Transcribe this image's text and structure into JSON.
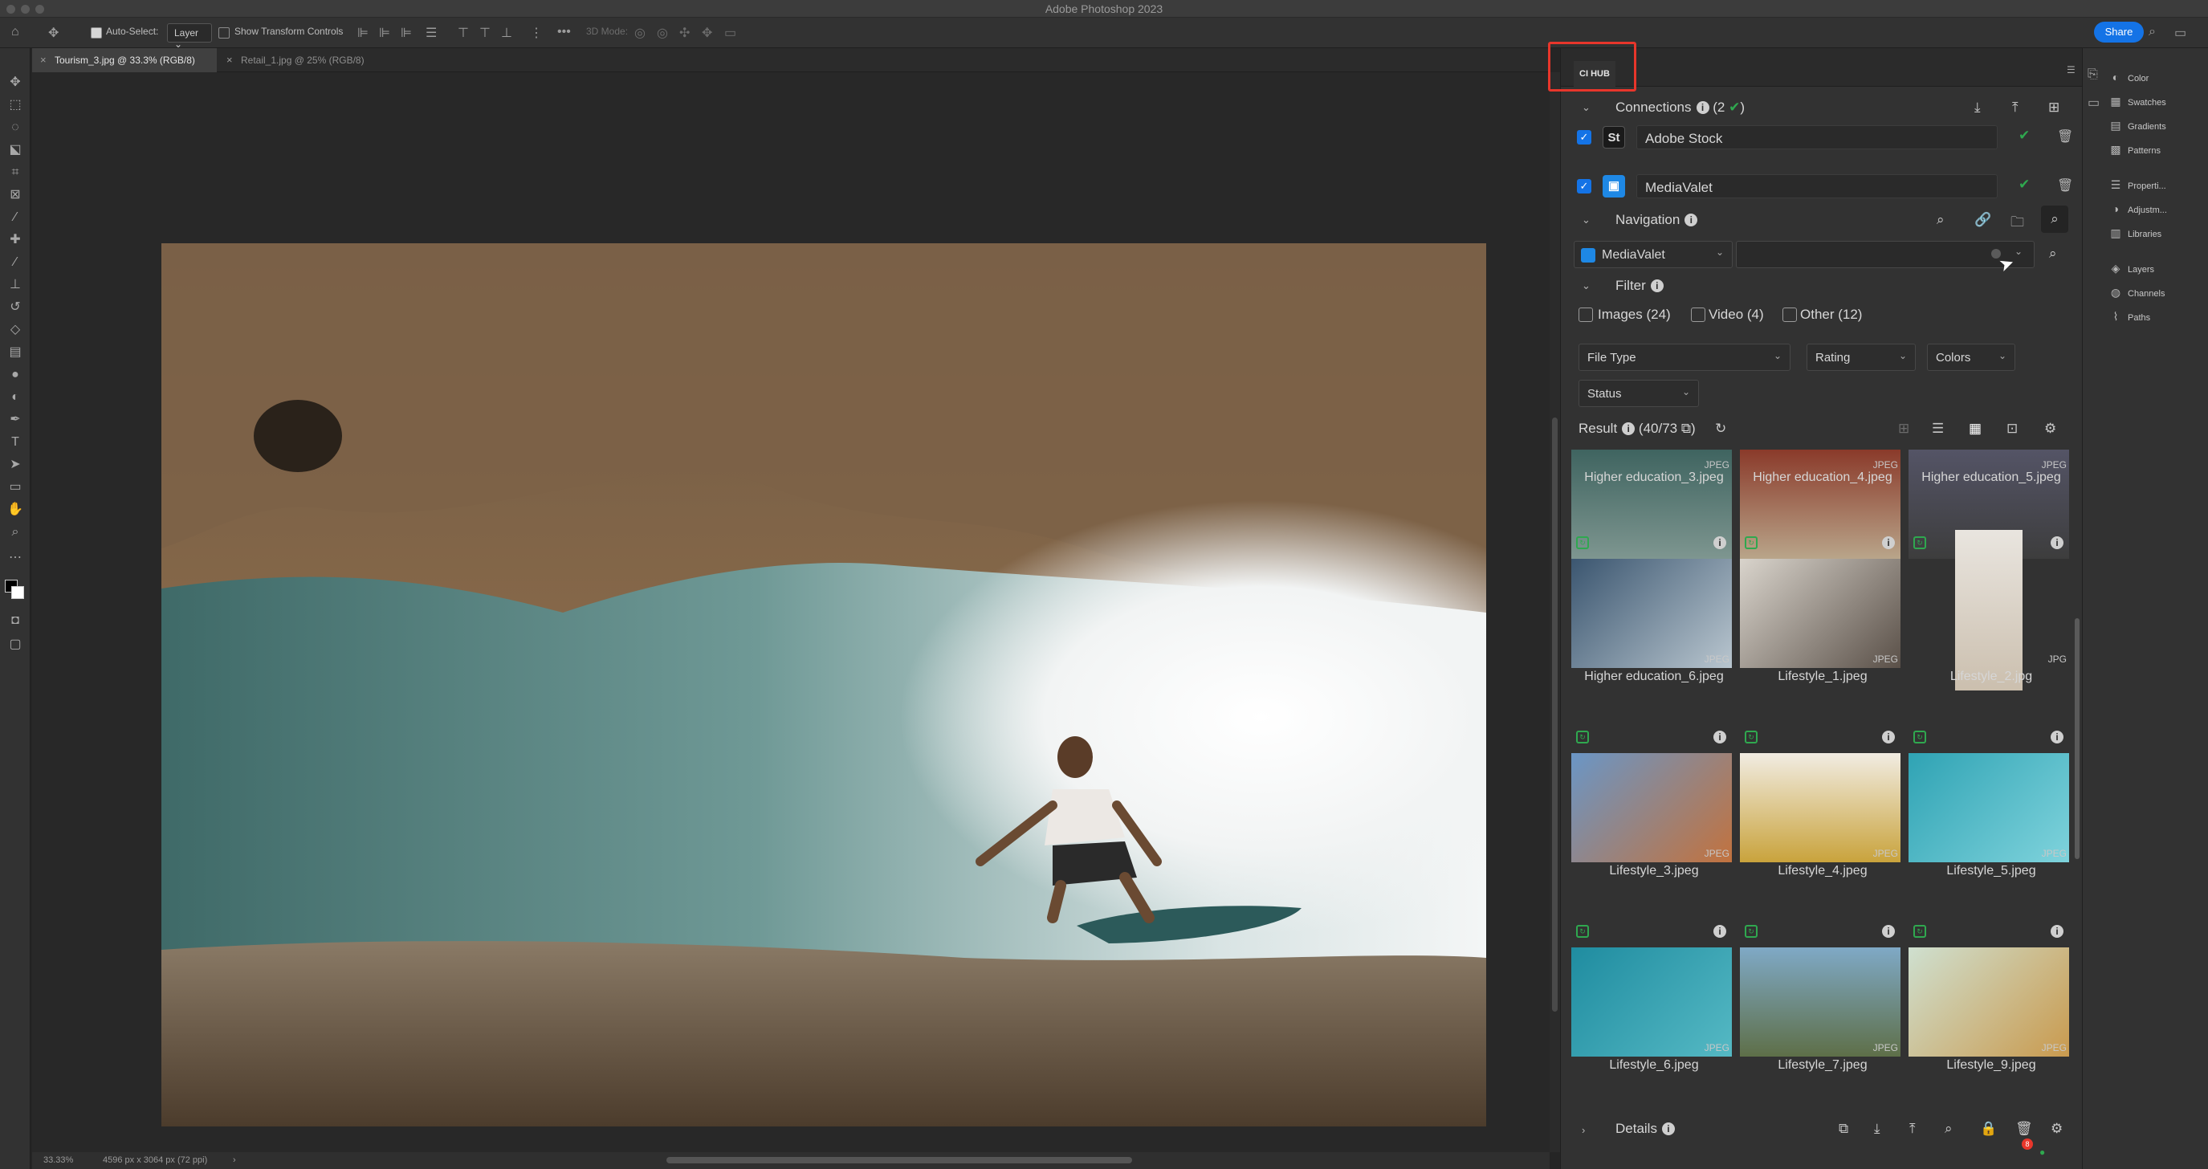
{
  "app": {
    "title": "Adobe Photoshop 2023"
  },
  "options_bar": {
    "auto_select_label": "Auto-Select:",
    "auto_select_value": "Layer",
    "show_transform_label": "Show Transform Controls",
    "mode_label": "3D Mode:",
    "more": "•••",
    "share_label": "Share"
  },
  "tabs": [
    {
      "label": "Tourism_3.jpg @ 33.3% (RGB/8)",
      "active": true
    },
    {
      "label": "Retail_1.jpg @ 25% (RGB/8)",
      "active": false
    }
  ],
  "status_bar": {
    "zoom": "33.33%",
    "doc_size": "4596 px x 3064 px (72 ppi)",
    "arrow": "›"
  },
  "tools": [
    "move-tool",
    "artboard-tool",
    "lasso-tool",
    "quick-select-tool",
    "crop-tool",
    "frame-tool",
    "eyedropper-tool",
    "healing-tool",
    "brush-tool",
    "stamp-tool",
    "history-brush-tool",
    "eraser-tool",
    "gradient-tool",
    "blur-tool",
    "dodge-tool",
    "pen-tool",
    "type-tool",
    "path-select-tool",
    "rectangle-tool",
    "hand-tool",
    "zoom-tool",
    "more-tools",
    "color-swatches",
    "quick-mask",
    "screen-mode"
  ],
  "panel": {
    "tab_label": "CI HUB",
    "connections": {
      "label": "Connections",
      "count": "(2",
      "items": [
        {
          "name": "Adobe Stock",
          "logo": "St",
          "logo_color": "#1a1a1a"
        },
        {
          "name": "MediaValet",
          "logo": "",
          "logo_color": "#1e88e5"
        }
      ]
    },
    "navigation": {
      "label": "Navigation",
      "source": "MediaValet",
      "search_value": ""
    },
    "filter": {
      "label": "Filter",
      "checks": [
        {
          "label": "Images (24)"
        },
        {
          "label": "Video (4)"
        },
        {
          "label": "Other (12)"
        }
      ],
      "selects": [
        "File Type",
        "Rating",
        "Colors",
        "Status"
      ]
    },
    "result": {
      "label": "Result",
      "count": "(40/73"
    },
    "assets": [
      {
        "name": "Higher education_3.jpeg",
        "ext": "JPEG"
      },
      {
        "name": "Higher education_4.jpeg",
        "ext": "JPEG"
      },
      {
        "name": "Higher education_5.jpeg",
        "ext": "JPEG"
      },
      {
        "name": "Higher education_6.jpeg",
        "ext": "JPEG"
      },
      {
        "name": "Lifestyle_1.jpeg",
        "ext": "JPEG"
      },
      {
        "name": "Lifestyle_2.jpg",
        "ext": "JPG"
      },
      {
        "name": "Lifestyle_3.jpeg",
        "ext": "JPEG"
      },
      {
        "name": "Lifestyle_4.jpeg",
        "ext": "JPEG"
      },
      {
        "name": "Lifestyle_5.jpeg",
        "ext": "JPEG"
      },
      {
        "name": "Lifestyle_6.jpeg",
        "ext": "JPEG"
      },
      {
        "name": "Lifestyle_7.jpeg",
        "ext": "JPEG"
      },
      {
        "name": "Lifestyle_9.jpeg",
        "ext": "JPEG"
      }
    ],
    "details": {
      "label": "Details",
      "badge": "8"
    }
  },
  "dock": [
    {
      "label": "Color",
      "icon": "color-icon"
    },
    {
      "label": "Swatches",
      "icon": "swatches-icon"
    },
    {
      "label": "Gradients",
      "icon": "gradients-icon"
    },
    {
      "label": "Patterns",
      "icon": "patterns-icon"
    },
    {
      "label": "Properti...",
      "icon": "properties-icon"
    },
    {
      "label": "Adjustm...",
      "icon": "adjustments-icon"
    },
    {
      "label": "Libraries",
      "icon": "libraries-icon"
    },
    {
      "label": "Layers",
      "icon": "layers-icon"
    },
    {
      "label": "Channels",
      "icon": "channels-icon"
    },
    {
      "label": "Paths",
      "icon": "paths-icon"
    }
  ],
  "colors": {
    "accent": "#1473e6",
    "highlight": "#e8362b",
    "ok": "#2fa84f"
  }
}
